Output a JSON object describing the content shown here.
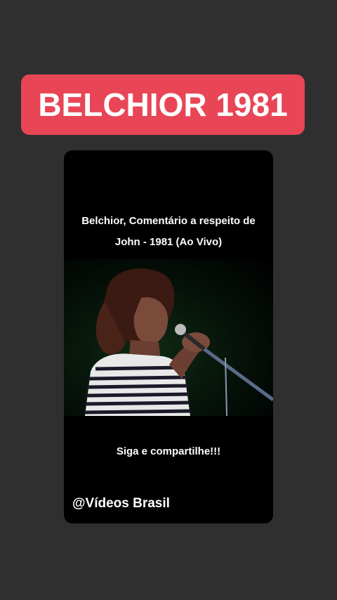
{
  "banner": {
    "title": "BELCHIOR 1981"
  },
  "video": {
    "caption_line1": "Belchior, Comentário a respeito de",
    "caption_line2": "John - 1981 (Ao Vivo)",
    "bottom_caption": "Siga e compartilhe!!!",
    "watermark": "@Vídeos Brasil"
  },
  "colors": {
    "background": "#2f2f2f",
    "banner": "#e84656",
    "card": "#000000",
    "text": "#ffffff"
  }
}
